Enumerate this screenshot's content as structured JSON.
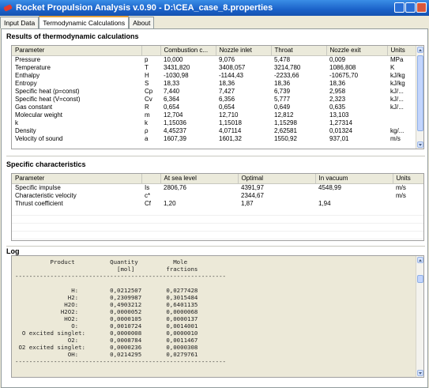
{
  "window": {
    "title": "Rocket Propulsion Analysis v.0.90 - D:\\CEA_case_8.properties"
  },
  "tabs": [
    {
      "label": "Input Data"
    },
    {
      "label": "Termodynamic Calculations"
    },
    {
      "label": "About"
    }
  ],
  "thermo": {
    "title": "Results of thermodynamic calculations",
    "columns": [
      "Parameter",
      "",
      "Combustion c...",
      "Nozzle inlet",
      "Throat",
      "Nozzle exit",
      "Units"
    ],
    "rows": [
      [
        "Pressure",
        "p",
        "10,000",
        "9,076",
        "5,478",
        "0,009",
        "MPa"
      ],
      [
        "Temperature",
        "T",
        "3431,820",
        "3408,057",
        "3214,780",
        "1086,808",
        "K"
      ],
      [
        "Enthalpy",
        "H",
        "-1030,98",
        "-1144,43",
        "-2233,66",
        "-10675,70",
        "kJ/kg"
      ],
      [
        "Entropy",
        "S",
        "18,33",
        "18,36",
        "18,36",
        "18,36",
        "kJ/kg"
      ],
      [
        "Specific heat (p=const)",
        "Cp",
        "7,440",
        "7,427",
        "6,739",
        "2,958",
        "kJ/..."
      ],
      [
        "Specific heat (V=const)",
        "Cv",
        "6,364",
        "6,356",
        "5,777",
        "2,323",
        "kJ/..."
      ],
      [
        "Gas constant",
        "R",
        "0,654",
        "0,654",
        "0,649",
        "0,635",
        "kJ/..."
      ],
      [
        "Molecular weight",
        "m",
        "12,704",
        "12,710",
        "12,812",
        "13,103",
        ""
      ],
      [
        "k",
        "k",
        "1,15036",
        "1,15018",
        "1,15298",
        "1,27314",
        ""
      ],
      [
        "Density",
        "ρ",
        "4,45237",
        "4,07114",
        "2,62581",
        "0,01324",
        "kg/..."
      ],
      [
        "Velocity of sound",
        "a",
        "1607,39",
        "1601,32",
        "1550,92",
        "937,01",
        "m/s"
      ]
    ]
  },
  "specific": {
    "title": "Specific characteristics",
    "columns": [
      "Parameter",
      "",
      "At sea level",
      "Optimal",
      "In vacuum",
      "Units"
    ],
    "rows": [
      [
        "Specific impulse",
        "Is",
        "2806,76",
        "4391,97",
        "4548,99",
        "m/s"
      ],
      [
        "Characteristic velocity",
        "c*",
        "",
        "2344,67",
        "",
        "m/s"
      ],
      [
        "Thrust coefficient",
        "Cf",
        "1,20",
        "1,87",
        "1,94",
        ""
      ]
    ]
  },
  "log": {
    "title": "Log",
    "lines": [
      "          Product          Quantity          Mole",
      "                             [mol]         fractions",
      "------------------------------------------------------------",
      "",
      "                H:         0,0212507       0,0277428",
      "               H2:         0,2309987       0,3015484",
      "              H2O:         0,4903212       0,6401135",
      "             H2O2:         0,0000052       0,0000068",
      "              HO2:         0,0000105       0,0000137",
      "                O:         0,0010724       0,0014001",
      "  O excited singlet:       0,0000008       0,0000010",
      "               O2:         0,0008784       0,0011467",
      " O2 excited singlet:       0,0000236       0,0000308",
      "               OH:         0,0214295       0,0279761",
      "------------------------------------------------------------"
    ]
  }
}
